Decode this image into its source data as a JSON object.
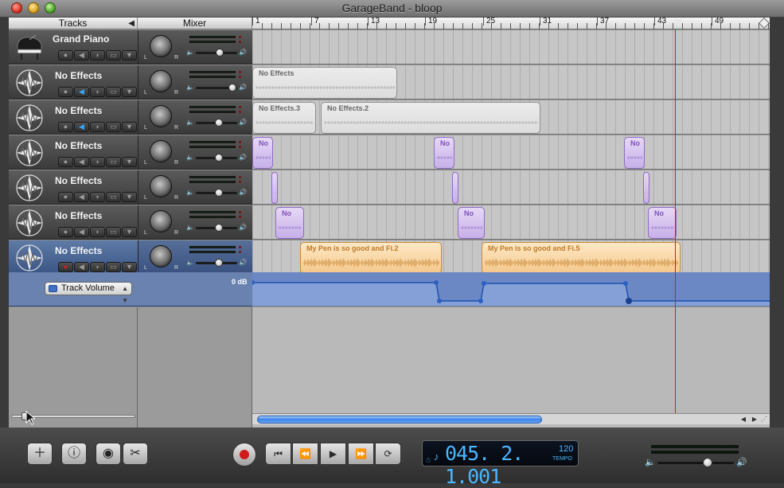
{
  "window": {
    "title": "GarageBand - bloop"
  },
  "headers": {
    "tracks": "Tracks",
    "mixer": "Mixer"
  },
  "ruler": {
    "markers": [
      "1",
      "7",
      "13",
      "19",
      "25",
      "31",
      "37",
      "43",
      "49"
    ]
  },
  "tracks": [
    {
      "name": "Grand Piano",
      "icon": "grand-piano-icon",
      "volume": 0.55
    },
    {
      "name": "No Effects",
      "icon": "waveform-star-icon",
      "volume": 0.88,
      "regions": [
        {
          "label": "No Effects",
          "color": "gray"
        }
      ]
    },
    {
      "name": "No Effects",
      "icon": "waveform-star-icon",
      "volume": 0.55,
      "regions": [
        {
          "label": "No Effects.3",
          "color": "gray"
        },
        {
          "label": "No Effects.2",
          "color": "gray"
        }
      ]
    },
    {
      "name": "No Effects",
      "icon": "waveform-star-icon",
      "volume": 0.55,
      "regions": [
        {
          "label": "No",
          "color": "purple"
        },
        {
          "label": "No",
          "color": "purple"
        },
        {
          "label": "No",
          "color": "purple"
        }
      ]
    },
    {
      "name": "No Effects",
      "icon": "waveform-star-icon",
      "volume": 0.55,
      "regions": [
        {
          "label": "",
          "color": "purple"
        },
        {
          "label": "",
          "color": "purple"
        },
        {
          "label": "",
          "color": "purple"
        }
      ]
    },
    {
      "name": "No Effects",
      "icon": "waveform-star-icon",
      "volume": 0.55,
      "regions": [
        {
          "label": "No",
          "color": "purple"
        },
        {
          "label": "No",
          "color": "purple"
        },
        {
          "label": "No",
          "color": "purple"
        }
      ]
    },
    {
      "name": "No Effects",
      "icon": "waveform-star-icon",
      "volume": 0.55,
      "selected": true,
      "regions": [
        {
          "label": "My Pen is so good and Fi.2",
          "color": "orange"
        },
        {
          "label": "My Pen is so good and Fi.5",
          "color": "orange"
        }
      ]
    }
  ],
  "automation": {
    "selected": "Track Volume",
    "db_label": "0 dB"
  },
  "transport": {
    "time_display": "045. 2. 1.001",
    "tempo_value": "120",
    "tempo_label": "TEMPO"
  },
  "knob_labels": {
    "left": "L",
    "right": "R"
  },
  "colors": {
    "playhead": "#d21e1e",
    "lcd_text": "#4ab6ff",
    "selected_track": "#3b5585"
  }
}
